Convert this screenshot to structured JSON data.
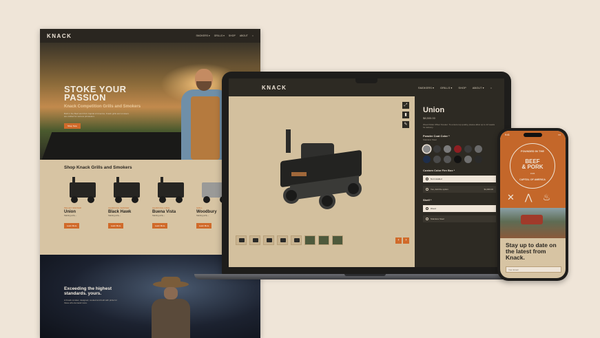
{
  "desktop": {
    "logo": "KNACK",
    "nav": [
      "SMOKERS ▾",
      "GRILLS ▾",
      "SHOP",
      "ABOUT",
      "○"
    ],
    "hero": {
      "title_line1": "STOKE YOUR",
      "title_line2": "PASSION",
      "subtitle": "Knack Competition Grills and Smokers",
      "copy": "Built in the Beef and Pork Capital of America, Knack grills and smokers are crafted for serious pitmasters.",
      "cta": "Shop Now"
    },
    "shop": {
      "title": "Shop Knack Grills and Smokers",
      "products": [
        {
          "tag": "PELLET SMOKER",
          "name": "Union",
          "meta": "Starting at $—",
          "cta": "Learn More"
        },
        {
          "tag": "CHARCOAL SMOKER",
          "name": "Black Hawk",
          "meta": "Starting at $—",
          "cta": "Learn More"
        },
        {
          "tag": "CHARCOAL GRILL",
          "name": "Buena Vista",
          "meta": "Starting at $—",
          "cta": "Learn More"
        },
        {
          "tag": "GRILL",
          "name": "Woodbury",
          "meta": "Starting at $—",
          "cta": "Learn More"
        }
      ]
    },
    "dark": {
      "title": "Exceeding the highest standards. yours.",
      "copy": "A Knack smoker, designed, cooked and built with pride for those who demand more."
    }
  },
  "laptop": {
    "logo": "KNACK",
    "nav": [
      "SMOKERS ▾",
      "GRILLS ▾",
      "SHOP",
      "ABOUT ▾",
      "○"
    ],
    "tools": [
      "⤢",
      "▮",
      "✎"
    ],
    "product": {
      "name": "Union",
      "price": "$8,500.00",
      "desc": "Wood Pellet Offset Smoker. To ensure top quality, please allow up to 12 weeks for delivery.",
      "powder_label": "Powder Coat Color *",
      "powder_sub": "Stainless Steel",
      "custom_label": "Custom Color Fire Box *",
      "options_custom": [
        {
          "text": "Not installed",
          "price": ""
        },
        {
          "text": "Yes, Add the option",
          "price": "$1,000.00"
        }
      ],
      "shelf_label": "Shelf *",
      "options_shelf": [
        {
          "text": "Wood",
          "price": ""
        },
        {
          "text": "Stainless Steel",
          "price": ""
        }
      ]
    },
    "swatches": [
      "#8a8a8a",
      "#3a3a3a",
      "#7c7c7c",
      "#8e1e22",
      "#3b3b3b",
      "#6a6a6a",
      "#1e2e4a",
      "#4a4a4a",
      "#565656",
      "#121212",
      "#707070",
      "#2a2a2a"
    ],
    "arrows": [
      "‹",
      "›"
    ]
  },
  "phone": {
    "status_time": "9:41",
    "status_icons": "▪▪▪",
    "badge": {
      "top": "FOUNDED IN THE",
      "big1": "BEEF",
      "big2": "& PORK",
      "year": "1936",
      "bottom": "CAPITAL OF AMERICA"
    },
    "icons": [
      "✕",
      "⋀",
      "♨"
    ],
    "headline": "Stay up to date on the latest from Knack.",
    "input_placeholder": "Your Email"
  },
  "colors": {
    "accent": "#d06a2a",
    "dark": "#2d2a23",
    "tan": "#d7c4a3",
    "background": "#efe5d8"
  }
}
